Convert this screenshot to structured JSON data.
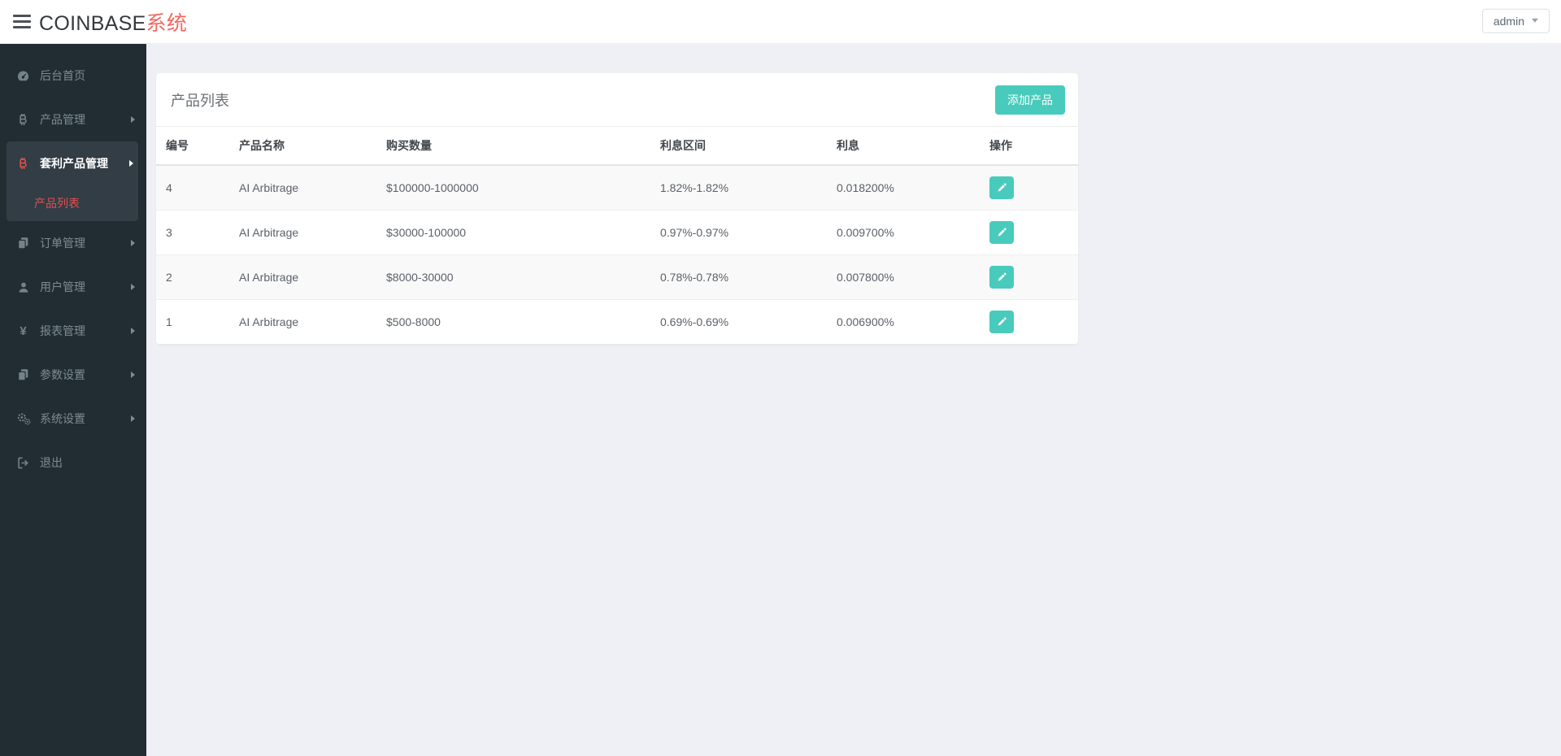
{
  "header": {
    "brand_primary": "COINBASE",
    "brand_accent": "系统",
    "user_menu_label": "admin"
  },
  "sidebar": {
    "items": [
      {
        "id": "dashboard",
        "label": "后台首页",
        "icon": "dashboard-icon",
        "has_arrow": false,
        "active": false
      },
      {
        "id": "product-manage",
        "label": "产品管理",
        "icon": "bitcoin-icon",
        "has_arrow": true,
        "active": false
      },
      {
        "id": "arbitrage-product-manage",
        "label": "套利产品管理",
        "icon": "bitcoin-icon",
        "has_arrow": true,
        "active": true,
        "children": [
          {
            "id": "product-list",
            "label": "产品列表",
            "active": true
          }
        ]
      },
      {
        "id": "order-manage",
        "label": "订单管理",
        "icon": "copy-icon",
        "has_arrow": true,
        "active": false
      },
      {
        "id": "user-manage",
        "label": "用户管理",
        "icon": "user-icon",
        "has_arrow": true,
        "active": false
      },
      {
        "id": "report-manage",
        "label": "报表管理",
        "icon": "yen-icon",
        "has_arrow": true,
        "active": false
      },
      {
        "id": "param-settings",
        "label": "参数设置",
        "icon": "copy-icon",
        "has_arrow": true,
        "active": false
      },
      {
        "id": "system-settings",
        "label": "系统设置",
        "icon": "gears-icon",
        "has_arrow": true,
        "active": false
      },
      {
        "id": "logout",
        "label": "退出",
        "icon": "logout-icon",
        "has_arrow": false,
        "active": false
      }
    ]
  },
  "main": {
    "card_title": "产品列表",
    "add_button_label": "添加产品",
    "table": {
      "headers": [
        "编号",
        "产品名称",
        "购买数量",
        "利息区间",
        "利息",
        "操作"
      ],
      "rows": [
        {
          "id": "4",
          "name": "AI Arbitrage",
          "amount": "$100000-1000000",
          "range": "1.82%-1.82%",
          "interest": "0.018200%"
        },
        {
          "id": "3",
          "name": "AI Arbitrage",
          "amount": "$30000-100000",
          "range": "0.97%-0.97%",
          "interest": "0.009700%"
        },
        {
          "id": "2",
          "name": "AI Arbitrage",
          "amount": "$8000-30000",
          "range": "0.78%-0.78%",
          "interest": "0.007800%"
        },
        {
          "id": "1",
          "name": "AI Arbitrage",
          "amount": "$500-8000",
          "range": "0.69%-0.69%",
          "interest": "0.006900%"
        }
      ]
    }
  },
  "colors": {
    "accent_teal": "#48cbbc",
    "brand_red": "#f4675f",
    "sidebar_active_red": "#e05151",
    "sidebar_bg": "#222d33",
    "sidebar_active_bg": "#323d45",
    "main_bg": "#eef0f5"
  }
}
